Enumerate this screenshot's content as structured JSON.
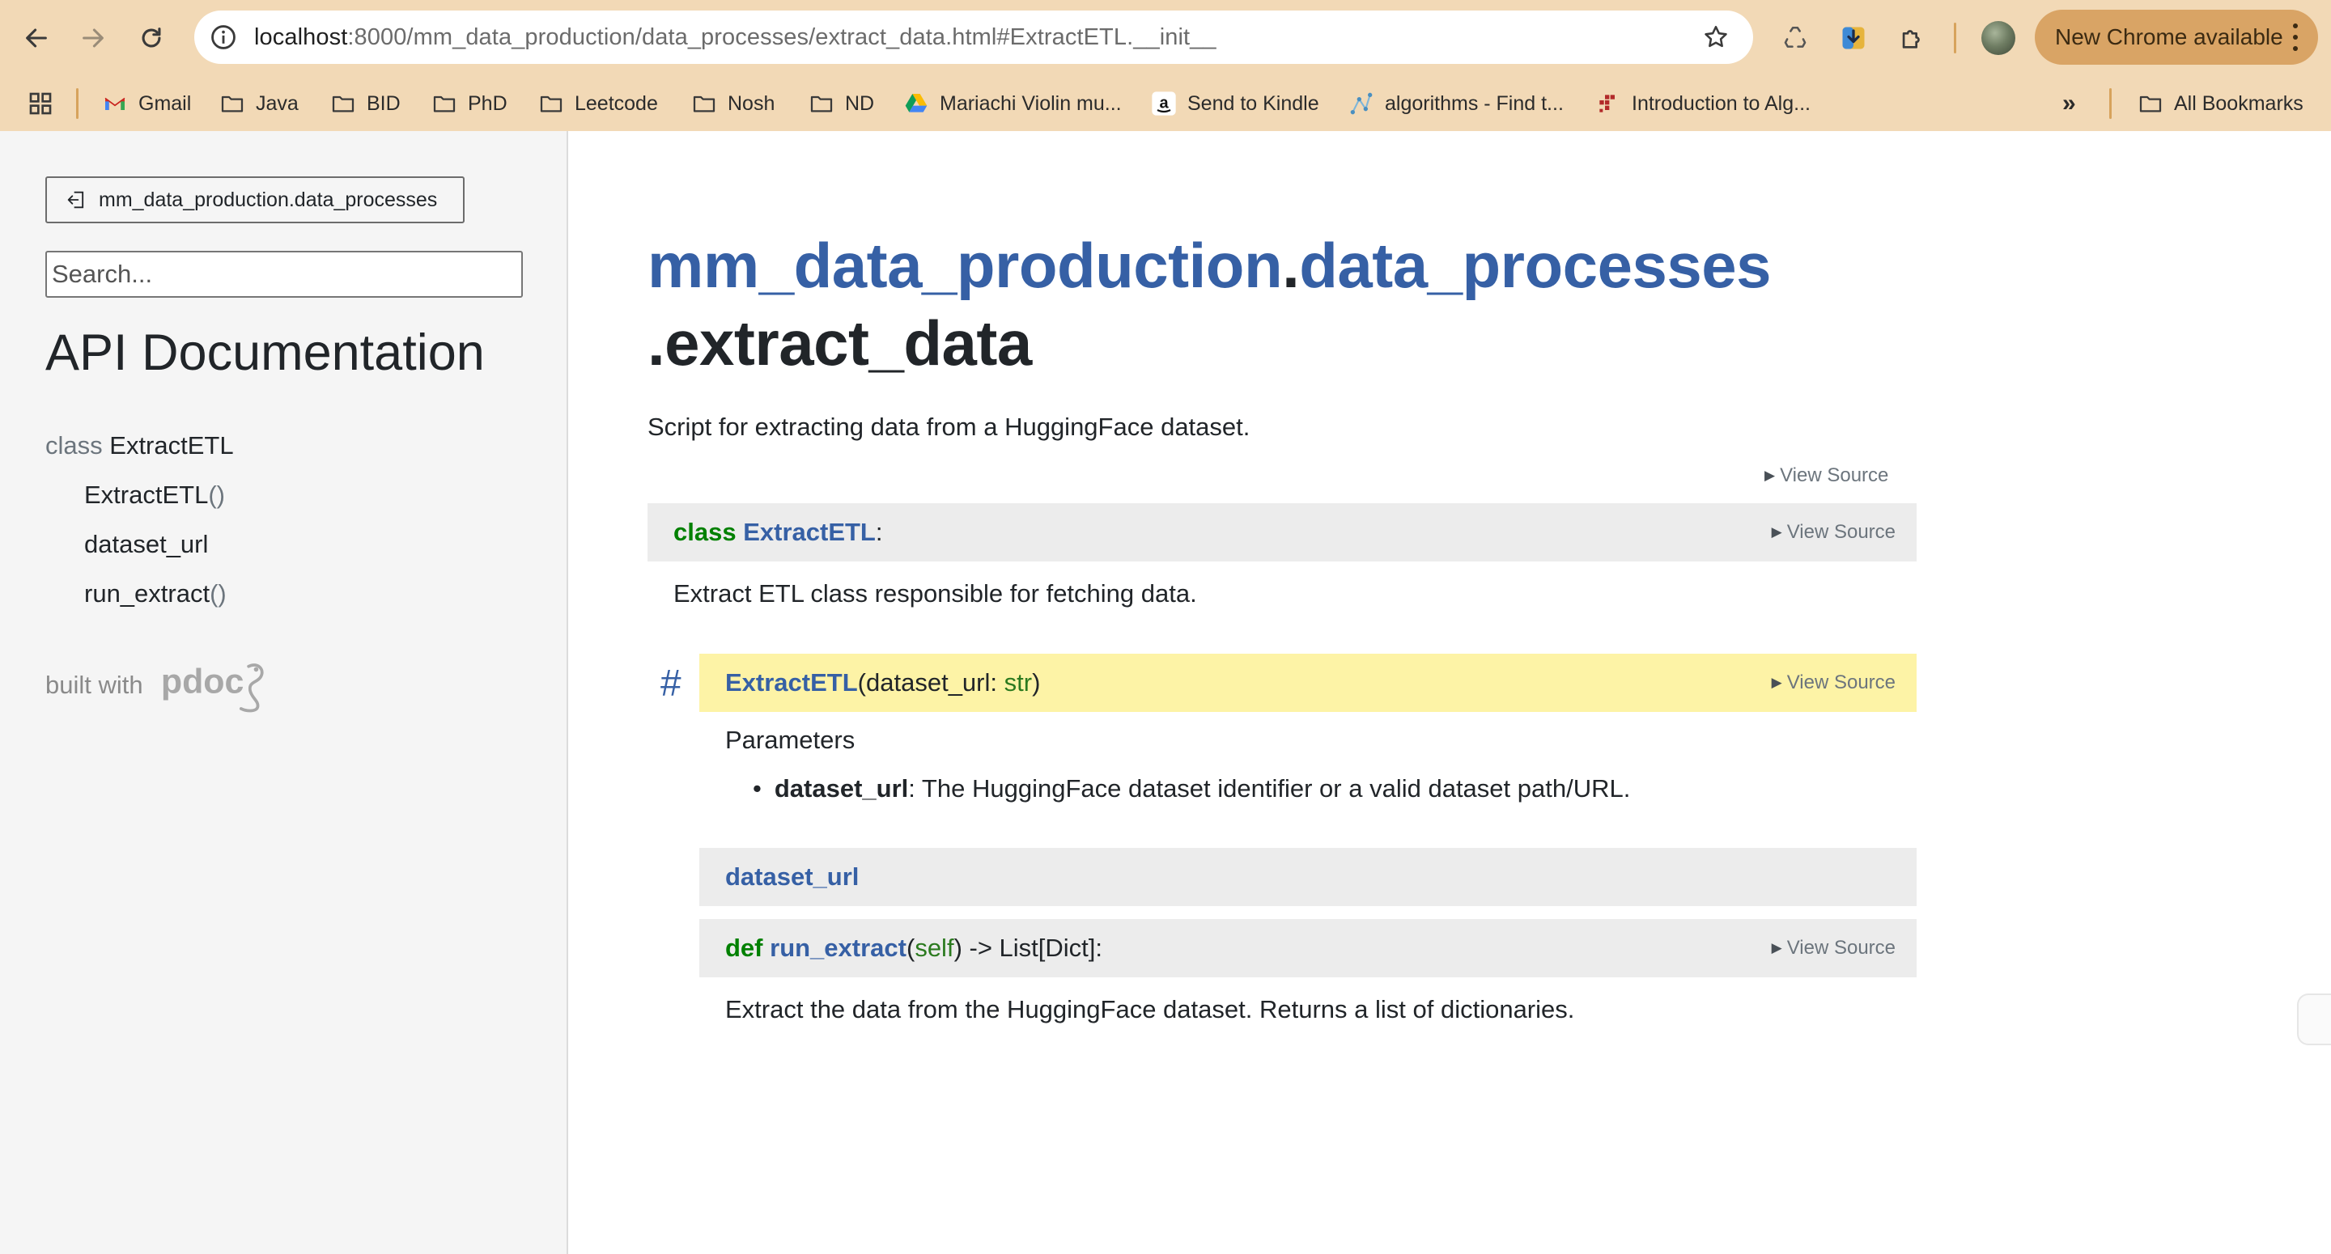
{
  "browser": {
    "url_host": "localhost",
    "url_rest": ":8000/mm_data_production/data_processes/extract_data.html#ExtractETL.__init__",
    "update_button_label": "New Chrome available",
    "toolbar_icons": [
      "back-arrow-icon",
      "forward-arrow-icon",
      "reload-icon",
      "site-info-icon",
      "bookmark-star-icon",
      "recycle-extension-icon",
      "download-extension-icon",
      "extensions-puzzle-icon",
      "profile-avatar",
      "kebab-menu-icon"
    ],
    "bookmarks": [
      {
        "label": "Gmail",
        "icon": "gmail-icon"
      },
      {
        "label": "Java",
        "icon": "folder-icon"
      },
      {
        "label": "BID",
        "icon": "folder-icon"
      },
      {
        "label": "PhD",
        "icon": "folder-icon"
      },
      {
        "label": "Leetcode",
        "icon": "folder-icon"
      },
      {
        "label": "Nosh",
        "icon": "folder-icon"
      },
      {
        "label": "ND",
        "icon": "folder-icon"
      },
      {
        "label": "Mariachi Violin mu...",
        "icon": "google-drive-icon"
      },
      {
        "label": "Send to Kindle",
        "icon": "amazon-icon"
      },
      {
        "label": "algorithms - Find t...",
        "icon": "graph-icon"
      },
      {
        "label": "Introduction to Alg...",
        "icon": "dots-logo-icon"
      }
    ],
    "bookmarks_overflow": "»",
    "all_bookmarks_label": "All Bookmarks"
  },
  "sidebar": {
    "back_label": "mm_data_production.data_processes",
    "search_placeholder": "Search...",
    "title": "API Documentation",
    "nav": {
      "class_kw": "class",
      "class_name": "ExtractETL",
      "items": [
        {
          "name": "ExtractETL",
          "suffix": "()"
        },
        {
          "name": "dataset_url",
          "suffix": ""
        },
        {
          "name": "run_extract",
          "suffix": "()"
        }
      ]
    },
    "built_with": "built with",
    "pdoc_logo": "pdoc"
  },
  "main": {
    "title_pkg1": "mm_data_production",
    "title_dot": ".",
    "title_pkg2": "data_processes",
    "title_mod": ".extract_data",
    "module_doc": "Script for extracting data from a HuggingFace dataset.",
    "view_source": "View Source",
    "class_sig": {
      "kw": "class",
      "name": "ExtractETL",
      "tail": ":"
    },
    "class_doc": "Extract ETL class responsible for fetching data.",
    "anchor": "#",
    "init_sig": {
      "name": "ExtractETL",
      "open": "(",
      "arg": "dataset_url",
      "colon": ": ",
      "ann": "str",
      "close": ")"
    },
    "params_heading": "Parameters",
    "param": {
      "name": "dataset_url",
      "desc": ": The HuggingFace dataset identifier or a valid dataset path/URL."
    },
    "attr_sig": {
      "name": "dataset_url"
    },
    "method_sig": {
      "kw": "def",
      "name": "run_extract",
      "open": "(",
      "arg": "self",
      "tail": ") -> List[Dict]:"
    },
    "method_doc": "Extract the data from the HuggingFace dataset. Returns a list of dictionaries."
  },
  "colors": {
    "chrome_frame": "#f2d9b6",
    "update_button": "#d9a465",
    "link_blue": "#3660a5",
    "keyword_green": "#008000",
    "highlight_yellow": "#fdf3a6",
    "sig_gray": "#ececec"
  }
}
